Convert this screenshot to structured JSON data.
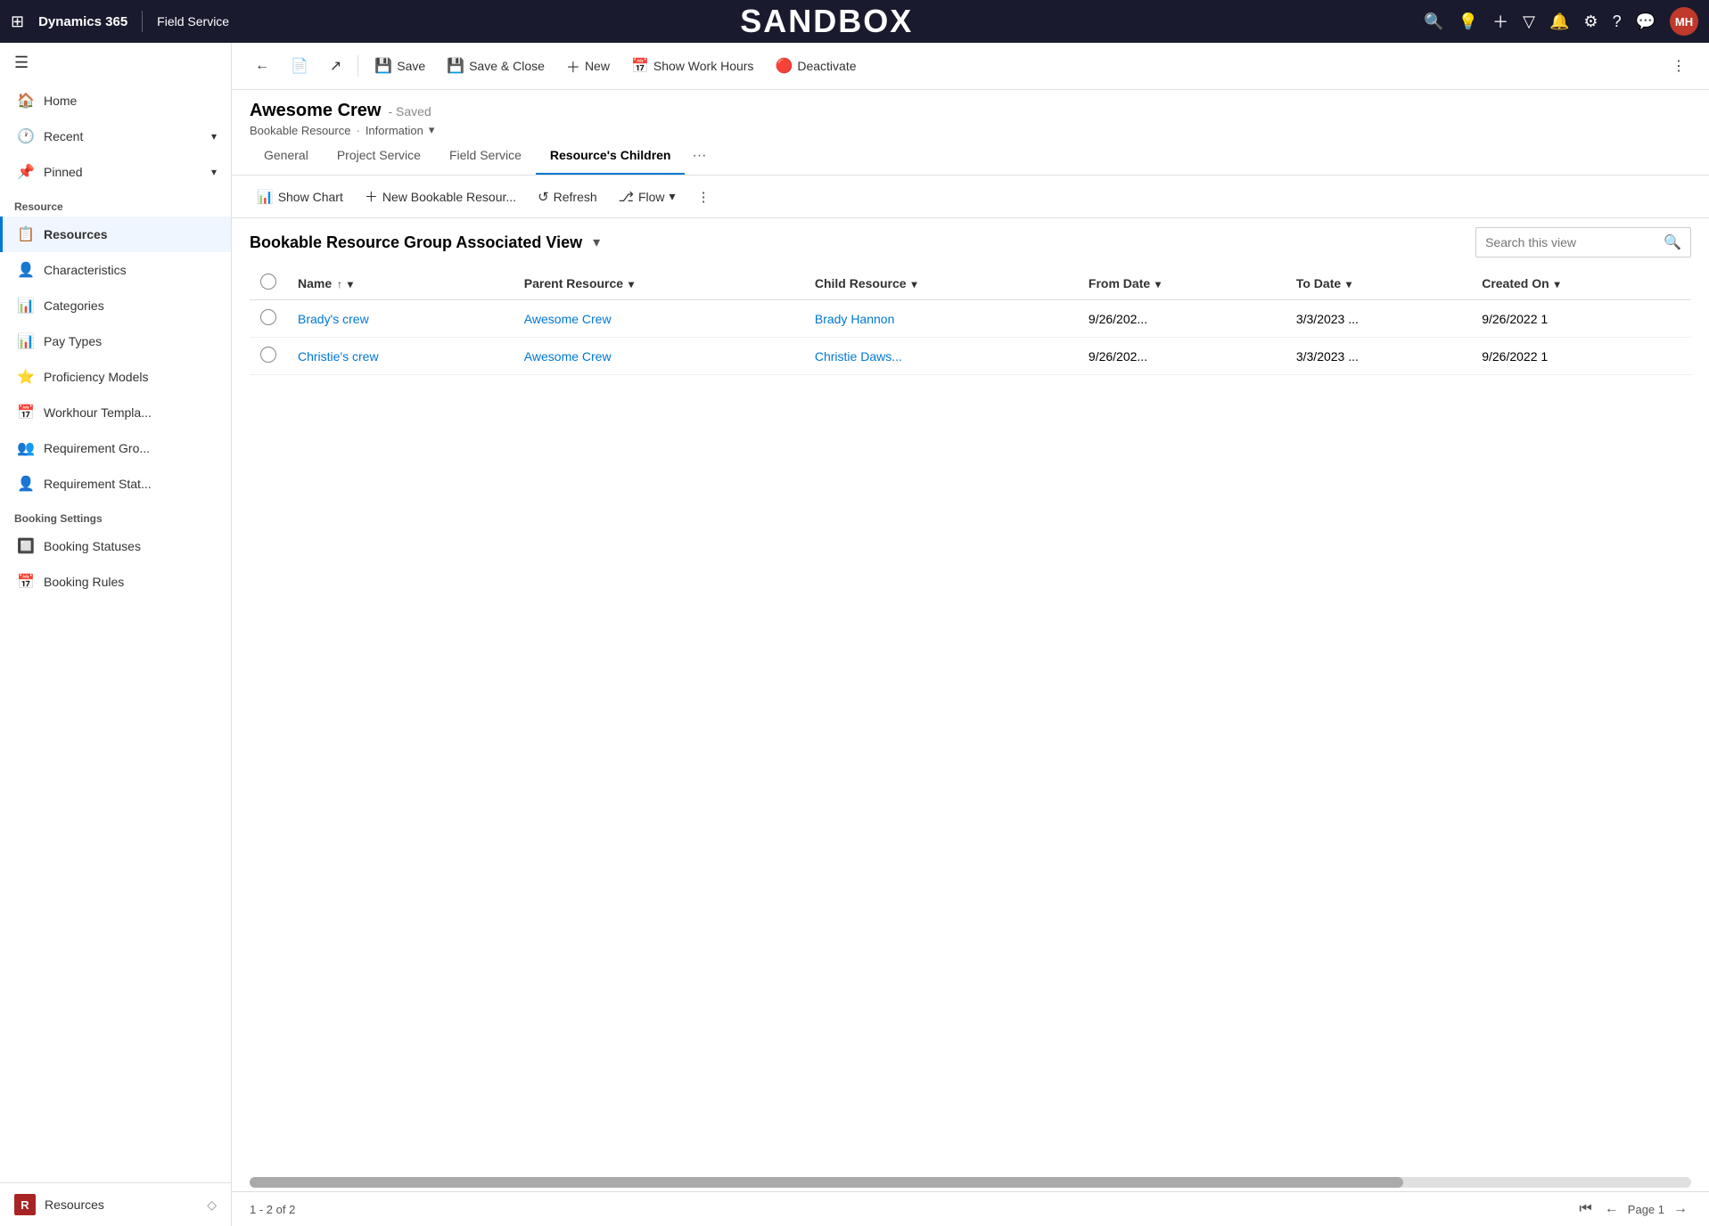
{
  "app": {
    "waffle_icon": "⊞",
    "name": "Dynamics 365",
    "divider": "|",
    "module": "Field Service",
    "sandbox_title": "SANDBOX"
  },
  "topnav_icons": {
    "search": "🔍",
    "lightbulb": "💡",
    "plus": "+",
    "filter": "⊞",
    "bell": "🔔",
    "gear": "⚙",
    "help": "?",
    "chat": "💬",
    "avatar_initials": "MH"
  },
  "toolbar": {
    "back_label": "←",
    "form_icon": "📄",
    "open_icon": "↗",
    "save_label": "Save",
    "save_close_label": "Save & Close",
    "new_label": "New",
    "show_work_hours_label": "Show Work Hours",
    "deactivate_label": "Deactivate",
    "more_icon": "⋮"
  },
  "record": {
    "title": "Awesome Crew",
    "saved_status": "- Saved",
    "entity": "Bookable Resource",
    "dot": "·",
    "view": "Information",
    "view_chevron": "▾"
  },
  "tabs": [
    {
      "id": "general",
      "label": "General"
    },
    {
      "id": "project-service",
      "label": "Project Service"
    },
    {
      "id": "field-service",
      "label": "Field Service"
    },
    {
      "id": "resources-children",
      "label": "Resource's Children",
      "active": true
    }
  ],
  "subgrid_toolbar": {
    "show_chart_label": "Show Chart",
    "show_chart_icon": "📊",
    "new_bookable_label": "New Bookable Resour...",
    "new_icon": "+",
    "refresh_label": "Refresh",
    "refresh_icon": "↺",
    "flow_label": "Flow",
    "flow_icon": "⎇",
    "flow_chevron": "▾",
    "more_icon": "⋮"
  },
  "view": {
    "title": "Bookable Resource Group Associated View",
    "title_chevron": "▾",
    "search_placeholder": "Search this view",
    "search_icon": "🔍"
  },
  "grid": {
    "columns": [
      {
        "id": "name",
        "label": "Name",
        "sort": "↑",
        "sort_chevron": "▾"
      },
      {
        "id": "parent-resource",
        "label": "Parent Resource",
        "sort_chevron": "▾"
      },
      {
        "id": "child-resource",
        "label": "Child Resource",
        "sort_chevron": "▾"
      },
      {
        "id": "from-date",
        "label": "From Date",
        "sort_chevron": "▾"
      },
      {
        "id": "to-date",
        "label": "To Date",
        "sort_chevron": "▾"
      },
      {
        "id": "created-on",
        "label": "Created On",
        "sort_chevron": "▾"
      }
    ],
    "rows": [
      {
        "name": "Brady's crew",
        "parent_resource": "Awesome Crew",
        "child_resource": "Brady Hannon",
        "from_date": "9/26/202...",
        "to_date": "3/3/2023 ...",
        "created_on": "9/26/2022 1"
      },
      {
        "name": "Christie's crew",
        "parent_resource": "Awesome Crew",
        "child_resource": "Christie Daws...",
        "from_date": "9/26/202...",
        "to_date": "3/3/2023 ...",
        "created_on": "9/26/2022 1"
      }
    ]
  },
  "footer": {
    "record_count": "1 - 2 of 2",
    "page_label": "Page 1",
    "first_icon": "⏮",
    "prev_icon": "←",
    "next_icon": "→"
  },
  "sidebar": {
    "menu_icon": "☰",
    "sections": [
      {
        "type": "item",
        "label": "Home",
        "icon": "🏠"
      },
      {
        "type": "item",
        "label": "Recent",
        "icon": "🕐",
        "chevron": "▾"
      },
      {
        "type": "item",
        "label": "Pinned",
        "icon": "📌",
        "chevron": "▾"
      }
    ],
    "resource_section_label": "Resource",
    "resource_items": [
      {
        "id": "resources",
        "label": "Resources",
        "icon": "📋",
        "active": true
      },
      {
        "id": "characteristics",
        "label": "Characteristics",
        "icon": "👤"
      },
      {
        "id": "categories",
        "label": "Categories",
        "icon": "📊"
      },
      {
        "id": "pay-types",
        "label": "Pay Types",
        "icon": "📊"
      },
      {
        "id": "proficiency-models",
        "label": "Proficiency Models",
        "icon": "⭐"
      },
      {
        "id": "workhour-templates",
        "label": "Workhour Templa...",
        "icon": "📅"
      },
      {
        "id": "requirement-groups",
        "label": "Requirement Gro...",
        "icon": "👥"
      },
      {
        "id": "requirement-statuses",
        "label": "Requirement Stat...",
        "icon": "👤"
      }
    ],
    "booking_section_label": "Booking Settings",
    "booking_items": [
      {
        "id": "booking-statuses",
        "label": "Booking Statuses",
        "icon": "🔲"
      },
      {
        "id": "booking-rules",
        "label": "Booking Rules",
        "icon": "📅"
      }
    ],
    "bottom_item": {
      "icon_letter": "R",
      "label": "Resources",
      "chevron": "◇"
    }
  }
}
